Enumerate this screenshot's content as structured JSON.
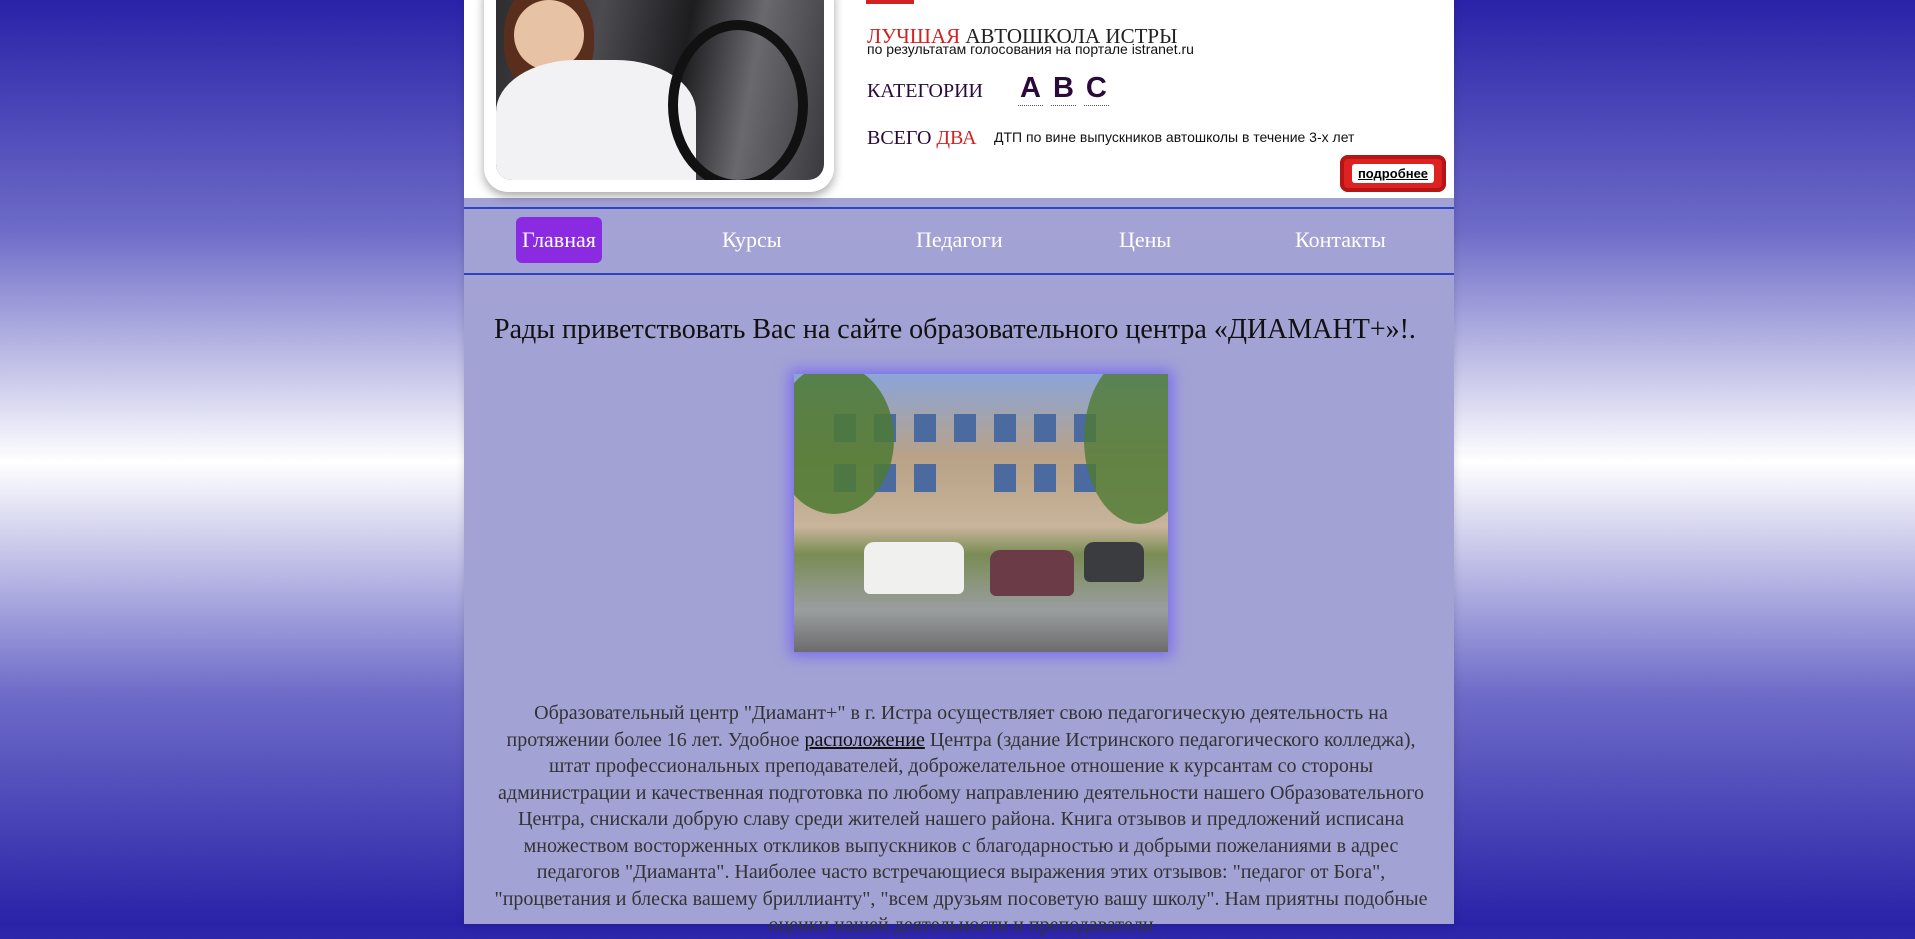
{
  "header": {
    "slogan_red": "ЛУЧШАЯ",
    "slogan_rest": "АВТОШКОЛА ИСТРЫ",
    "slogan_sub": "по результатам голосования на портале istranet.ru",
    "categories_label": "КАТЕГОРИИ",
    "categories": [
      "A",
      "B",
      "C"
    ],
    "total_label": "ВСЕГО",
    "total_red": "ДВА",
    "total_sub": "ДТП по вине выпускников автошколы в течение 3-х лет",
    "more_label": "подробнее"
  },
  "nav": {
    "items": [
      {
        "label": "Главная",
        "active": true
      },
      {
        "label": "Курсы",
        "active": false
      },
      {
        "label": "Педагоги",
        "active": false
      },
      {
        "label": "Цены",
        "active": false
      },
      {
        "label": "Контакты",
        "active": false
      }
    ]
  },
  "main": {
    "welcome": "Рады приветствовать Вас на сайте образовательного центра «ДИАМАНТ+»!.",
    "para_before_link": "Образовательный центр \"Диамант+\" в г. Истра осуществляет свою педагогическую деятельность на протяжении более 16 лет. Удобное ",
    "para_link": "расположение",
    "para_after_link": " Центра (здание Истринского педагогического колледжа), штат профессиональных преподавателей, доброжелательное отношение к курсантам со стороны администрации и качественная подготовка по любому направлению деятельности нашего Образовательного Центра, снискали добрую славу среди жителей нашего района. Книга отзывов и предложений исписана множеством восторженных откликов выпускников с благодарностью и добрыми пожеланиями в адрес педагогов \"Диаманта\". Наиболее часто встречающиеся выражения этих отзывов: \"педагог от Бога\", \"процветания и блеска вашему бриллианту\", \"всем друзьям посоветую вашу школу\". Нам приятны подобные оценки нашей деятельности и преподаватели"
  },
  "colors": {
    "accent_red": "#d12222",
    "nav_active": "#8a2be2",
    "nav_border": "#2d43c5",
    "page_bg": "#a3a2d4"
  }
}
